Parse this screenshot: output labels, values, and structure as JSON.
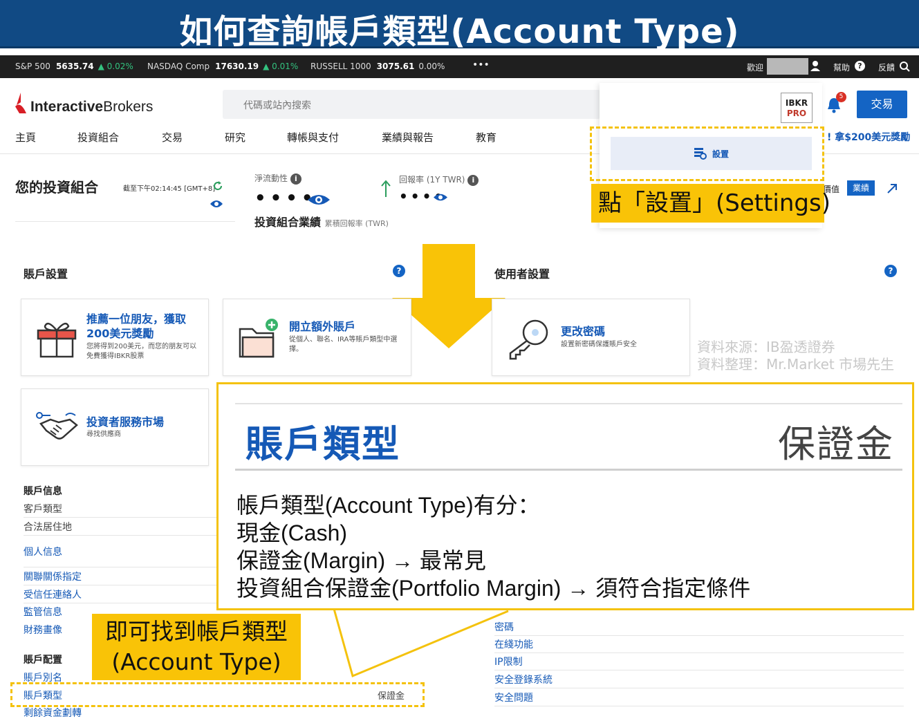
{
  "banner": {
    "title": "如何查詢帳戶類型(Account Type)"
  },
  "ticker": {
    "items": [
      {
        "name": "S&P 500",
        "value": "5635.74",
        "change": "▲ 0.02%"
      },
      {
        "name": "NASDAQ Comp",
        "value": "17630.19",
        "change": "▲ 0.01%"
      },
      {
        "name": "RUSSELL 1000",
        "value": "3075.61",
        "change": "0.00%"
      }
    ],
    "more": "•••",
    "welcome": "歡迎",
    "help": "幫助",
    "feedback": "反饋"
  },
  "header": {
    "logo_bold": "Interactive",
    "logo_light": "Brokers",
    "search_placeholder": "代碼或站內搜索",
    "nav": [
      "主頁",
      "投資組合",
      "交易",
      "研究",
      "轉帳與支付",
      "業績與報告",
      "教育"
    ],
    "pro_line1": "IBKR",
    "pro_line2": "PRO",
    "notif_count": "5",
    "trade_button": "交易",
    "promo": "! 拿$200美元獎勵"
  },
  "dropdown": {
    "settings_label": "設置"
  },
  "portfolio": {
    "title": "您的投資組合",
    "timestamp": "截至下午02:14:45 [GMT+8]",
    "net_liquidity_label": "淨流動性",
    "masked": "••••",
    "return_label": "回報率 (1Y TWR)",
    "perf_title": "投資組合業績",
    "perf_sub": "累積回報率 (TWR)",
    "tab_value": "價值",
    "tab_perf": "業績"
  },
  "callouts": {
    "settings": "點「設置」(Settings)",
    "found_line1": "即可找到帳戶類型",
    "found_line2": "(Account Type)"
  },
  "account_settings": {
    "title": "賬戶設置",
    "cards": [
      {
        "title": "推薦一位朋友，獲取200美元獎勵",
        "desc": "您將得到200美元，而您的朋友可以免費獲得IBKR股票"
      },
      {
        "title": "開立額外賬戶",
        "desc": "從個人、聯名、IRA等賬戶類型中選擇。"
      },
      {
        "title": "投資者服務市場",
        "desc": "尋找供應商"
      }
    ]
  },
  "user_settings": {
    "title": "使用者設置",
    "cards": [
      {
        "title": "更改密碼",
        "desc": "設置新密碼保護賬戶安全"
      }
    ]
  },
  "watermark": {
    "line1": "資料來源：IB盈透證券",
    "line2": "資料整理：Mr.Market 市場先生"
  },
  "zoom": {
    "left": "賬戶類型",
    "right": "保證金",
    "lines": [
      "帳戶類型(Account Type)有分：",
      "現金(Cash)",
      "保證金(Margin) → 最常見",
      "投資組合保證金(Portfolio Margin) → 須符合指定條件"
    ]
  },
  "account_info": {
    "title": "賬戶信息",
    "items": [
      "客戶類型",
      "合法居住地",
      "個人信息",
      "關聯關係指定",
      "受信任連絡人",
      "監管信息",
      "財務畫像"
    ]
  },
  "account_config": {
    "title": "賬戶配置",
    "items": [
      "賬戶別名",
      "賬戶類型",
      "剩餘資金劃轉"
    ],
    "account_type_value": "保證金"
  },
  "security": {
    "items": [
      "密碼",
      "在綫功能",
      "IP限制",
      "安全登錄系統",
      "安全問題"
    ]
  }
}
